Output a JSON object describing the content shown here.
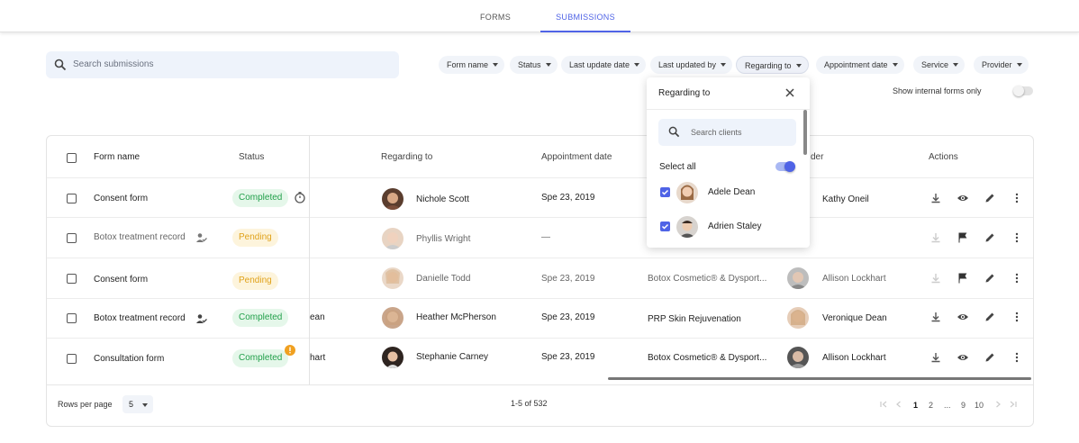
{
  "tabs": [
    {
      "label": "FORMS",
      "active": false
    },
    {
      "label": "SUBMISSIONS",
      "active": true
    }
  ],
  "search": {
    "placeholder": "Search submissions",
    "icon": "search-icon"
  },
  "filters": [
    {
      "label": "Form name"
    },
    {
      "label": "Status"
    },
    {
      "label": "Last update date"
    },
    {
      "label": "Last updated by"
    },
    {
      "label": "Regarding to",
      "open": true
    },
    {
      "label": "Appointment date"
    },
    {
      "label": "Service"
    },
    {
      "label": "Provider"
    }
  ],
  "internal_toggle": {
    "label": "Show internal forms only",
    "on": false
  },
  "table": {
    "headers": {
      "form_name": "Form name",
      "status": "Status",
      "regarding": "Regarding to",
      "appointment": "Appointment date",
      "provider_partial": "der",
      "actions": "Actions"
    },
    "rows": [
      {
        "form": "Consent form",
        "form_icon": "",
        "status": "Completed",
        "status_type": "done",
        "status_extra": "timer-icon",
        "prev_col_fragment": "",
        "regarding": "Nichole Scott",
        "regarding_muted": false,
        "appointment": "Spe 23, 2019",
        "service": "",
        "provider": "Kathy Oneil",
        "provider_muted": false,
        "download_enabled": true,
        "second_action": "eye-icon"
      },
      {
        "form": "Botox treatment record",
        "form_icon": "person-check-icon",
        "status": "Pending",
        "status_type": "pend",
        "status_extra": "",
        "prev_col_fragment": "",
        "regarding": "Phyllis Wright",
        "regarding_muted": true,
        "appointment": "—",
        "service": "",
        "provider": "",
        "provider_muted": true,
        "download_enabled": false,
        "second_action": "flag-icon"
      },
      {
        "form": "Consent form",
        "form_icon": "",
        "status": "Pending",
        "status_type": "pend",
        "status_extra": "",
        "prev_col_fragment": "",
        "regarding": "Danielle Todd",
        "regarding_muted": true,
        "appointment": "Spe 23, 2019",
        "service": "Botox Cosmetic® & Dysport...",
        "provider": "Allison Lockhart",
        "provider_muted": true,
        "download_enabled": false,
        "second_action": "flag-icon"
      },
      {
        "form": "Botox treatment record",
        "form_icon": "person-check-icon",
        "status": "Completed",
        "status_type": "done",
        "status_extra": "",
        "prev_col_fragment": "ean",
        "regarding": "Heather McPherson",
        "regarding_muted": false,
        "appointment": "Spe 23, 2019",
        "service": "PRP Skin Rejuvenation",
        "provider": "Veronique Dean",
        "provider_muted": false,
        "download_enabled": true,
        "second_action": "eye-icon"
      },
      {
        "form": "Consultation form",
        "form_icon": "",
        "status": "Completed",
        "status_type": "done",
        "status_extra": "warning-dot-icon",
        "prev_col_fragment": "hart",
        "regarding": "Stephanie Carney",
        "regarding_muted": false,
        "appointment": "Spe 23, 2019",
        "service": "Botox Cosmetic® & Dysport...",
        "provider": "Allison Lockhart",
        "provider_muted": false,
        "download_enabled": true,
        "second_action": "eye-icon"
      }
    ]
  },
  "footer": {
    "rows_per_page_label": "Rows per page",
    "rows_per_page_value": "5",
    "range": "1-5 of 532",
    "pages": [
      "1",
      "2",
      "...",
      "9",
      "10"
    ],
    "current_page": "1"
  },
  "dropdown": {
    "title": "Regarding to",
    "search_placeholder": "Search clients",
    "select_all_label": "Select all",
    "select_all_on": true,
    "items": [
      {
        "name": "Adele Dean",
        "checked": true
      },
      {
        "name": "Adrien Staley",
        "checked": true
      }
    ]
  },
  "colors": {
    "accent": "#4f63e6",
    "completed_text": "#22a04b",
    "completed_bg": "#e5f7ea",
    "pending_text": "#e0a21a",
    "pending_bg": "#fdf4dc",
    "warning": "#f0a020"
  }
}
